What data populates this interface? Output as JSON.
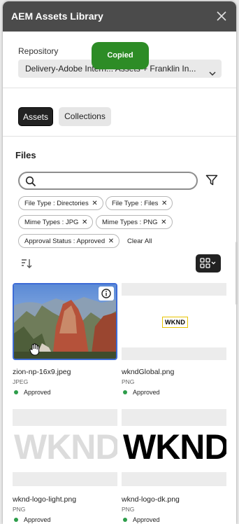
{
  "window": {
    "title": "AEM Assets Library",
    "close_icon": "close-icon"
  },
  "repository": {
    "label": "Repository",
    "value": "Delivery-Adobe Intern... Assets + Franklin In..."
  },
  "toast": {
    "text": "Copied",
    "color": "#2d8c26"
  },
  "tabs": [
    {
      "label": "Assets",
      "selected": true
    },
    {
      "label": "Collections",
      "selected": false
    }
  ],
  "files": {
    "heading": "Files",
    "search_placeholder": "",
    "filters": [
      {
        "label": "File Type : Directories"
      },
      {
        "label": "File Type : Files"
      },
      {
        "label": "Mime Types : JPG"
      },
      {
        "label": "Mime Types : PNG"
      },
      {
        "label": "Approval Status : Approved"
      }
    ],
    "remove_glyph": "✕",
    "clear_all": "Clear All"
  },
  "assets": [
    {
      "name": "zion-np-16x9.jpeg",
      "type": "JPEG",
      "status": "Approved",
      "selected": true
    },
    {
      "name": "wkndGlobal.png",
      "type": "PNG",
      "status": "Approved",
      "logo": "WKND"
    },
    {
      "name": "wknd-logo-light.png",
      "type": "PNG",
      "status": "Approved",
      "logo": "WKND"
    },
    {
      "name": "wknd-logo-dk.png",
      "type": "PNG",
      "status": "Approved",
      "logo": "WKND"
    }
  ],
  "colors": {
    "accent_selected": "#3d6bd6",
    "status_approved": "#2d9d4a",
    "titlebar": "#4b4b4b"
  }
}
